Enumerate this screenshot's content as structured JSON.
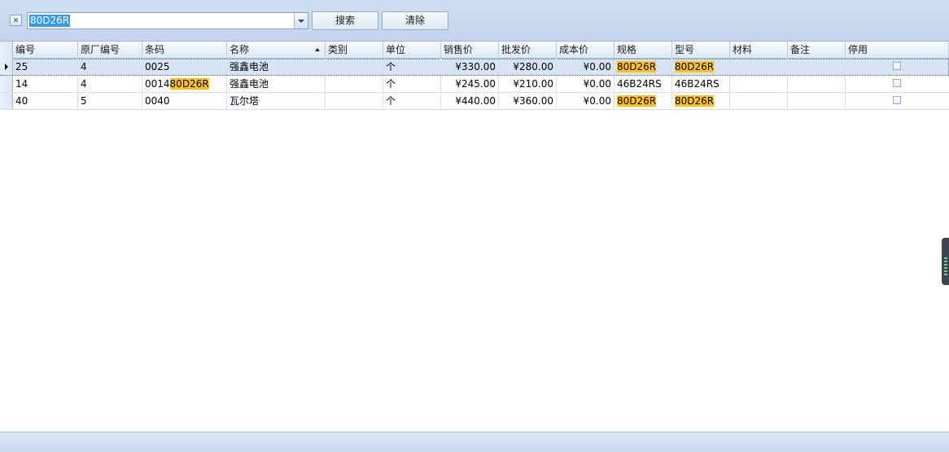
{
  "search": {
    "query": "80D26R",
    "search_label": "搜索",
    "reset_label": "清除"
  },
  "grid": {
    "columns": [
      "编号",
      "原厂编号",
      "条码",
      "名称",
      "类别",
      "单位",
      "销售价",
      "批发价",
      "成本价",
      "规格",
      "型号",
      "材料",
      "备注",
      "停用"
    ],
    "sorted_column": "名称",
    "highlight_color": "#ffc21a",
    "rows": [
      {
        "id": "25",
        "factory_no": "4",
        "barcode": "0025",
        "barcode_match": "",
        "name": "强鑫电池",
        "category": "",
        "unit": "个",
        "sale_price": "¥330.00",
        "wholesale_price": "¥280.00",
        "cost_price": "¥0.00",
        "spec": "80D26R",
        "spec_highlight": true,
        "model": "80D26R",
        "model_highlight": true,
        "material": "",
        "remark": "",
        "disabled": false,
        "focused": true
      },
      {
        "id": "14",
        "factory_no": "4",
        "barcode": "0014",
        "barcode_match": "80D26R",
        "name": "强鑫电池",
        "category": "",
        "unit": "个",
        "sale_price": "¥245.00",
        "wholesale_price": "¥210.00",
        "cost_price": "¥0.00",
        "spec": "46B24RS",
        "spec_highlight": false,
        "model": "46B24RS",
        "model_highlight": false,
        "material": "",
        "remark": "",
        "disabled": false,
        "focused": false
      },
      {
        "id": "40",
        "factory_no": "5",
        "barcode": "0040",
        "barcode_match": "",
        "name": "瓦尔塔",
        "category": "",
        "unit": "个",
        "sale_price": "¥440.00",
        "wholesale_price": "¥360.00",
        "cost_price": "¥0.00",
        "spec": "80D26R",
        "spec_highlight": true,
        "model": "80D26R",
        "model_highlight": true,
        "material": "",
        "remark": "",
        "disabled": false,
        "focused": false
      }
    ]
  }
}
